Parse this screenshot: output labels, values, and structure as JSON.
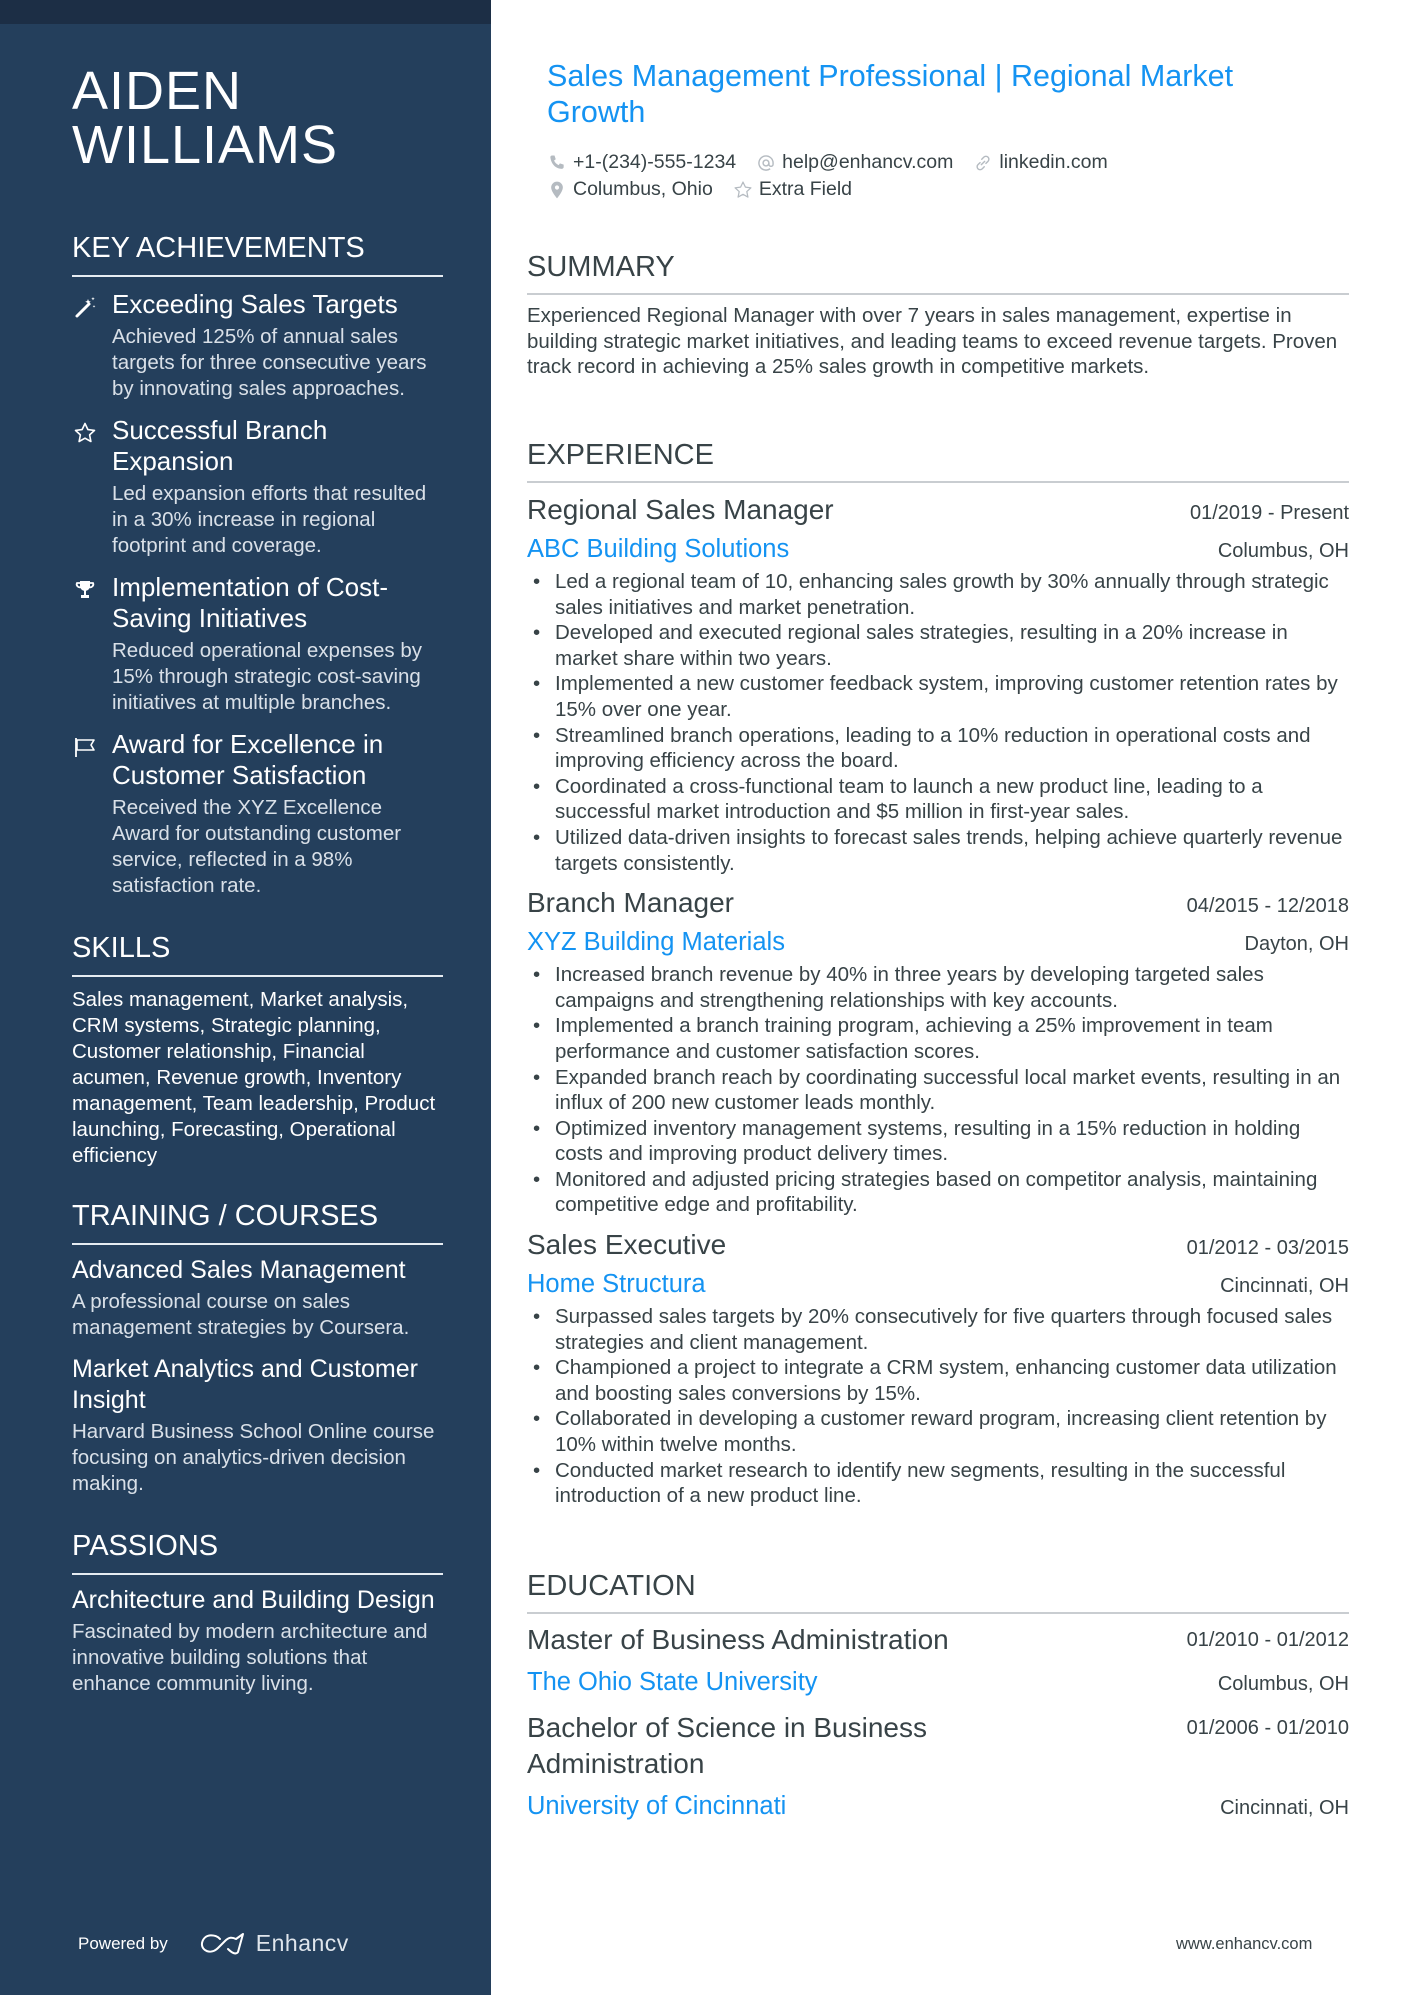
{
  "person": {
    "first_name": "AIDEN",
    "last_name": "WILLIAMS",
    "headline": "Sales Management Professional | Regional Market Growth"
  },
  "contacts": {
    "phone": {
      "icon": "phone-icon",
      "value": "+1-(234)-555-1234"
    },
    "email": {
      "icon": "at-icon",
      "value": "help@enhancv.com"
    },
    "website": {
      "icon": "link-icon",
      "value": "linkedin.com"
    },
    "location": {
      "icon": "location-pin-icon",
      "value": "Columbus, Ohio"
    },
    "extra": {
      "icon": "star-icon",
      "value": "Extra Field"
    }
  },
  "sidebar": {
    "achievements": {
      "title": "KEY ACHIEVEMENTS",
      "items": [
        {
          "icon": "magic-wand-icon",
          "title": "Exceeding Sales Targets",
          "desc": "Achieved 125% of annual sales targets for three consecutive years by innovating sales approaches."
        },
        {
          "icon": "star-icon",
          "title": "Successful Branch Expansion",
          "desc": "Led expansion efforts that resulted in a 30% increase in regional footprint and coverage."
        },
        {
          "icon": "trophy-icon",
          "title": "Implementation of Cost-Saving Initiatives",
          "desc": "Reduced operational expenses by 15% through strategic cost-saving initiatives at multiple branches."
        },
        {
          "icon": "flag-icon",
          "title": "Award for Excellence in Customer Satisfaction",
          "desc": "Received the XYZ Excellence Award for outstanding customer service, reflected in a 98% satisfaction rate."
        }
      ]
    },
    "skills": {
      "title": "SKILLS",
      "text": "Sales management, Market analysis, CRM systems, Strategic planning, Customer relationship, Financial acumen, Revenue growth, Inventory management, Team leadership, Product launching, Forecasting, Operational efficiency"
    },
    "training": {
      "title": "TRAINING / COURSES",
      "items": [
        {
          "title": "Advanced Sales Management",
          "desc": "A professional course on sales management strategies by Coursera."
        },
        {
          "title": "Market Analytics and Customer Insight",
          "desc": "Harvard Business School Online course focusing on analytics-driven decision making."
        }
      ]
    },
    "passions": {
      "title": "PASSIONS",
      "items": [
        {
          "title": "Architecture and Building Design",
          "desc": "Fascinated by modern architecture and innovative building solutions that enhance community living."
        }
      ]
    },
    "footer": {
      "powered_by": "Powered by",
      "brand": "Enhancv"
    }
  },
  "summary": {
    "title": "SUMMARY",
    "text": "Experienced Regional Manager with over 7 years in sales management, expertise in building strategic market initiatives, and leading teams to exceed revenue targets. Proven track record in achieving a 25% sales growth in competitive markets."
  },
  "experience": {
    "title": "EXPERIENCE",
    "jobs": [
      {
        "title": "Regional Sales Manager",
        "dates": "01/2019 - Present",
        "company": "ABC Building Solutions",
        "location": "Columbus, OH",
        "bullets": [
          "Led a regional team of 10, enhancing sales growth by 30% annually through strategic sales initiatives and market penetration.",
          "Developed and executed regional sales strategies, resulting in a 20% increase in market share within two years.",
          "Implemented a new customer feedback system, improving customer retention rates by 15% over one year.",
          "Streamlined branch operations, leading to a 10% reduction in operational costs and improving efficiency across the board.",
          "Coordinated a cross-functional team to launch a new product line, leading to a successful market introduction and $5 million in first-year sales.",
          "Utilized data-driven insights to forecast sales trends, helping achieve quarterly revenue targets consistently."
        ]
      },
      {
        "title": "Branch Manager",
        "dates": "04/2015 - 12/2018",
        "company": "XYZ Building Materials",
        "location": "Dayton, OH",
        "bullets": [
          "Increased branch revenue by 40% in three years by developing targeted sales campaigns and strengthening relationships with key accounts.",
          "Implemented a branch training program, achieving a 25% improvement in team performance and customer satisfaction scores.",
          "Expanded branch reach by coordinating successful local market events, resulting in an influx of 200 new customer leads monthly.",
          "Optimized inventory management systems, resulting in a 15% reduction in holding costs and improving product delivery times.",
          "Monitored and adjusted pricing strategies based on competitor analysis, maintaining competitive edge and profitability."
        ]
      },
      {
        "title": "Sales Executive",
        "dates": "01/2012 - 03/2015",
        "company": "Home Structura",
        "location": "Cincinnati, OH",
        "bullets": [
          "Surpassed sales targets by 20% consecutively for five quarters through focused sales strategies and client management.",
          "Championed a project to integrate a CRM system, enhancing customer data utilization and boosting sales conversions by 15%.",
          "Collaborated in developing a customer reward program, increasing client retention by 10% within twelve months.",
          "Conducted market research to identify new segments, resulting in the successful introduction of a new product line."
        ]
      }
    ]
  },
  "education": {
    "title": "EDUCATION",
    "items": [
      {
        "degree": "Master of Business Administration",
        "dates": "01/2010 - 01/2012",
        "school": "The Ohio State University",
        "location": "Columbus, OH"
      },
      {
        "degree": "Bachelor of Science in Business Administration",
        "dates": "01/2006 - 01/2010",
        "school": "University of Cincinnati",
        "location": "Cincinnati, OH"
      }
    ]
  },
  "footer": {
    "site": "www.enhancv.com"
  },
  "colors": {
    "sidebar_bg": "#243f5c",
    "accent": "#1493f2",
    "text": "#384347"
  }
}
